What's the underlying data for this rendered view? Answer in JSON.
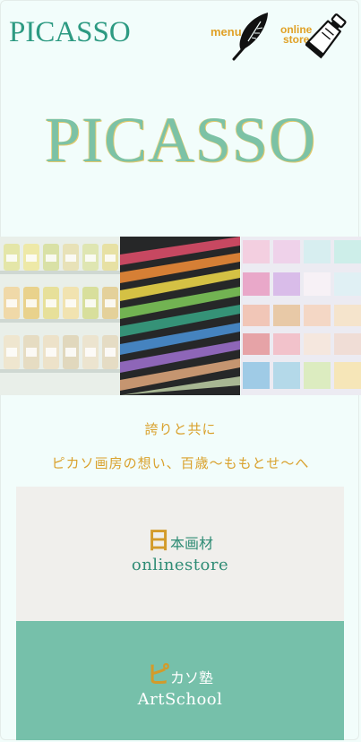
{
  "header": {
    "logo": "PICASSO",
    "menu_label": "menu",
    "store_label_line1": "online",
    "store_label_line2": "store",
    "menu_icon": "feather-icon",
    "store_icon": "paint-tube-icon"
  },
  "hero": {
    "logo": "PICASSO"
  },
  "photos": [
    {
      "name": "bottles-photo"
    },
    {
      "name": "pastels-photo"
    },
    {
      "name": "pastel-boxes-photo"
    }
  ],
  "tagline": {
    "line1": "誇りと共に",
    "line2": "ピカソ画房の想い、百歳〜ももとせ〜へ"
  },
  "cards": {
    "store": {
      "initial": "日",
      "title_rest": "本画材",
      "subtitle": "onlinestore"
    },
    "school": {
      "initial": "ピ",
      "title_rest": "カソ塾",
      "subtitle": "ArtSchool"
    }
  },
  "colors": {
    "background": "#f2fdfb",
    "brand_green": "#2d9a82",
    "accent_gold": "#e0a126",
    "card_store_bg": "#f0efec",
    "card_school_bg": "#76c0aa"
  }
}
